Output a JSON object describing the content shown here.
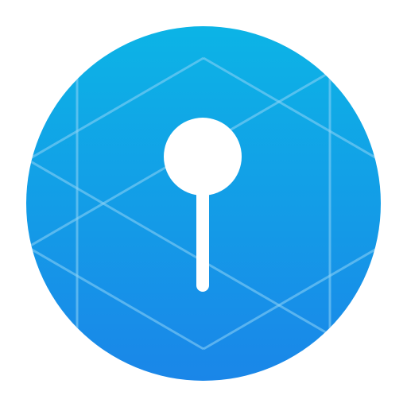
{
  "app_icon": {
    "icon": "keyhole-icon",
    "colors": {
      "background": "#ffffff",
      "gradient_top": "#0cb4e6",
      "gradient_bottom": "#1a86e8",
      "grid_lines": "#8fd3f5",
      "keyhole": "#ffffff"
    }
  }
}
